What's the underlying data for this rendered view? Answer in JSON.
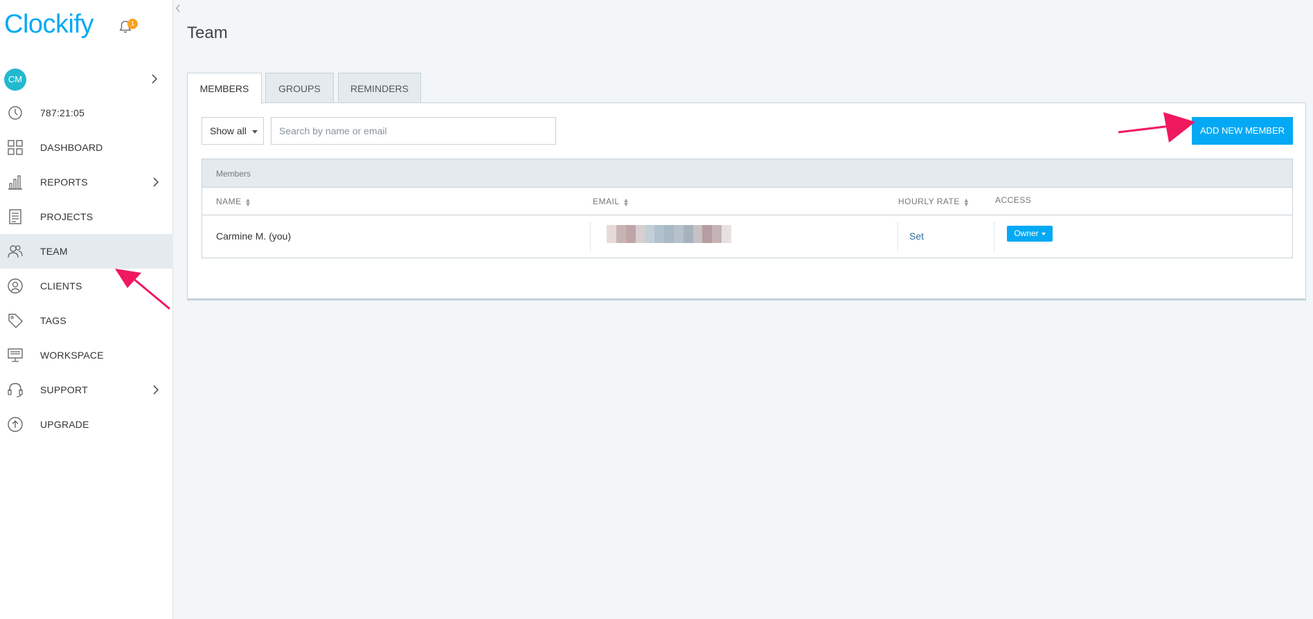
{
  "app": {
    "logo_text": "Clockify",
    "notification_count": "1"
  },
  "colors": {
    "brand": "#03a9f4",
    "active_nav_bg": "#e4eaee",
    "badge": "#f7a324",
    "annotation_arrow": "#f0185e"
  },
  "sidebar": {
    "workspace_avatar": "CM",
    "items": [
      {
        "label": "787:21:05",
        "icon": "clock-icon"
      },
      {
        "label": "DASHBOARD",
        "icon": "dashboard-icon"
      },
      {
        "label": "REPORTS",
        "icon": "bar-chart-icon",
        "has_submenu": true
      },
      {
        "label": "PROJECTS",
        "icon": "document-icon"
      },
      {
        "label": "TEAM",
        "icon": "team-icon",
        "active": true
      },
      {
        "label": "CLIENTS",
        "icon": "client-icon"
      },
      {
        "label": "TAGS",
        "icon": "tag-icon"
      },
      {
        "label": "WORKSPACE",
        "icon": "monitor-icon"
      },
      {
        "label": "SUPPORT",
        "icon": "headset-icon",
        "has_submenu": true
      },
      {
        "label": "UPGRADE",
        "icon": "upgrade-icon"
      }
    ]
  },
  "main": {
    "title": "Team",
    "tabs": [
      {
        "label": "MEMBERS",
        "active": true
      },
      {
        "label": "GROUPS"
      },
      {
        "label": "REMINDERS"
      }
    ],
    "filter": {
      "selected": "Show all"
    },
    "search": {
      "placeholder": "Search by name or email"
    },
    "add_button": "ADD NEW MEMBER",
    "table": {
      "section_label": "Members",
      "columns": [
        "NAME",
        "EMAIL",
        "HOURLY RATE",
        "ACCESS"
      ],
      "rows": [
        {
          "name": "Carmine M. (you)",
          "email": "",
          "hourly_rate": "Set",
          "access": "Owner"
        }
      ]
    }
  }
}
